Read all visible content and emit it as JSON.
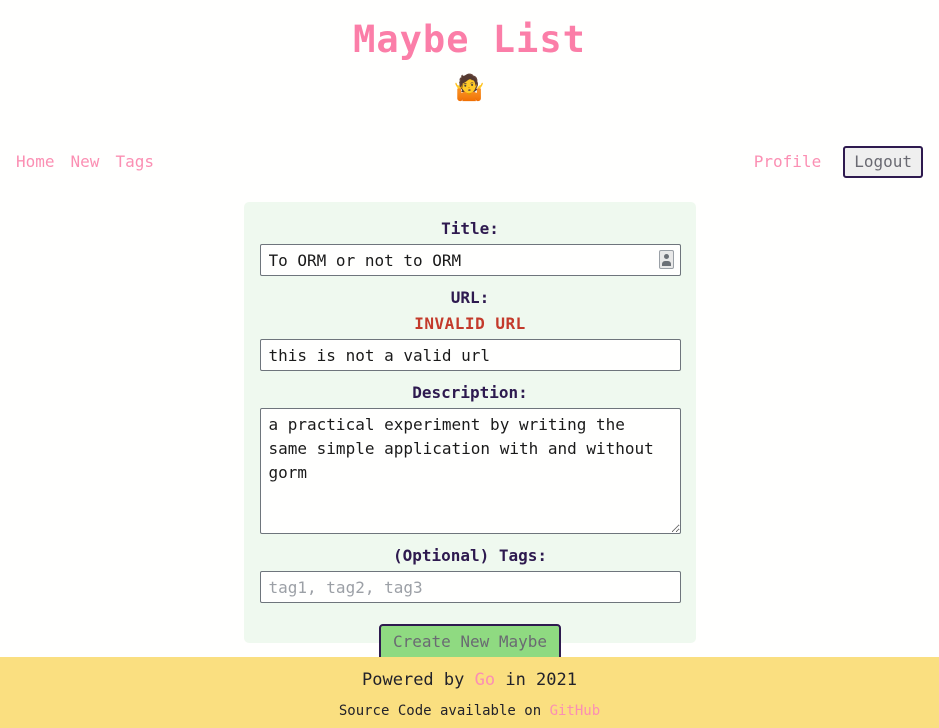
{
  "header": {
    "site_title": "Maybe List",
    "emoji": "🤷",
    "emoji_name": "person-shrugging-emoji",
    "title_color": "#FB7EA8"
  },
  "nav": {
    "left_links": [
      {
        "label": "Home",
        "name": "nav-link-home"
      },
      {
        "label": "New",
        "name": "nav-link-new"
      },
      {
        "label": "Tags",
        "name": "nav-link-tags"
      }
    ],
    "profile_label": "Profile",
    "logout_label": "Logout"
  },
  "form": {
    "title_label": "Title:",
    "title_value": "To ORM or not to ORM",
    "title_autofill_icon": "contact-card-icon",
    "url_label": "URL:",
    "url_error": "INVALID URL",
    "url_value": "this is not a valid url",
    "description_label": "Description:",
    "description_value": "a practical experiment by writing the same simple application with and without gorm",
    "tags_label": "(Optional) Tags:",
    "tags_value": "",
    "tags_placeholder": "tag1, tag2, tag3",
    "submit_label": "Create New Maybe",
    "panel_color": "#EFF9EF",
    "error_color": "#C33A2B",
    "submit_color": "#8FDA81"
  },
  "footer": {
    "line1_prefix": "Powered by ",
    "line1_link": "Go",
    "line1_suffix": " in 2021",
    "line2_prefix": "Source Code available on ",
    "line2_link": "GitHub",
    "background_color": "#FADF80"
  }
}
